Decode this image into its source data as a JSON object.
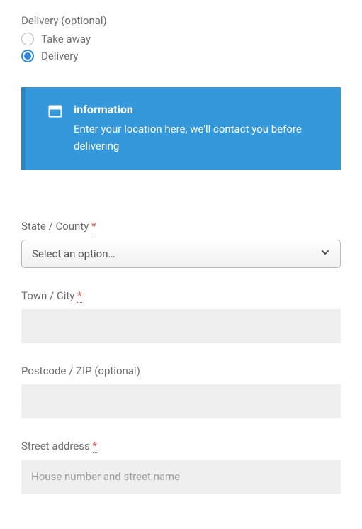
{
  "delivery": {
    "label": "Delivery (optional)",
    "options": [
      "Take away",
      "Delivery"
    ],
    "selected": "Delivery"
  },
  "info": {
    "title": "information",
    "body": "Enter your location here, we'll contact you before delivering"
  },
  "fields": {
    "state": {
      "label": "State / County",
      "required": true,
      "placeholder": "Select an option…",
      "value": ""
    },
    "city": {
      "label": "Town / City",
      "required": true,
      "value": ""
    },
    "postcode": {
      "label": "Postcode / ZIP (optional)",
      "required": false,
      "value": ""
    },
    "street": {
      "label": "Street address",
      "required": true,
      "placeholder": "House number and street name",
      "value": ""
    }
  },
  "required_marker": "*"
}
